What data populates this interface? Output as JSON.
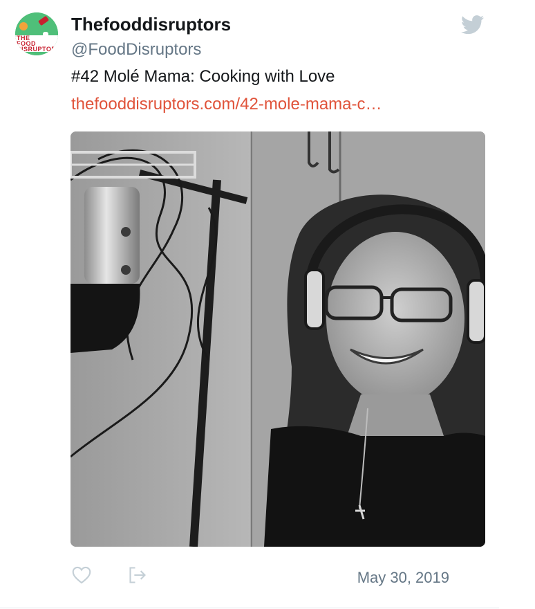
{
  "tweet": {
    "display_name": "Thefooddisruptors",
    "handle": "@FoodDisruptors",
    "text": "#42 Molé Mama: Cooking with Love",
    "link_text": "thefooddisruptors.com/42-mole-mama-c…",
    "timestamp": "May 30, 2019"
  },
  "avatar": {
    "logo_lines": [
      "THE",
      "FOOD",
      "DISRUPTORS"
    ]
  },
  "icons": {
    "brand": "twitter-bird-icon",
    "like": "heart-icon",
    "share": "share-icon"
  },
  "colors": {
    "link": "#e0533a",
    "handle": "#657786",
    "twitter_blue_muted": "#c4cfd6",
    "avatar_green": "#4fbf79"
  }
}
